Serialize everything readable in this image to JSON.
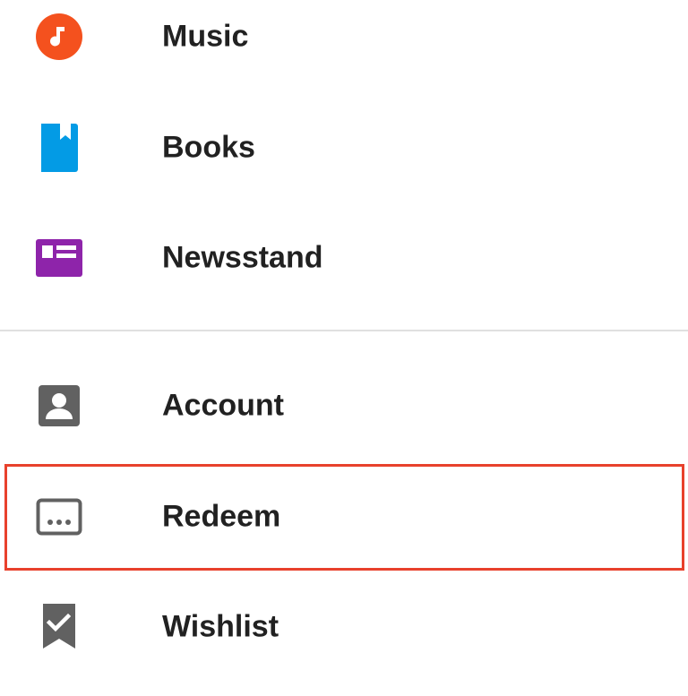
{
  "menu": {
    "items": [
      {
        "label": "Music",
        "icon": "music-note-icon",
        "icon_color": "#f4511e"
      },
      {
        "label": "Books",
        "icon": "bookmark-book-icon",
        "icon_color": "#039be5"
      },
      {
        "label": "Newsstand",
        "icon": "newsstand-icon",
        "icon_color": "#8e24aa"
      },
      {
        "label": "Account",
        "icon": "account-icon",
        "icon_color": "#616161"
      },
      {
        "label": "Redeem",
        "icon": "redeem-card-icon",
        "icon_color": "#616161"
      },
      {
        "label": "Wishlist",
        "icon": "wishlist-icon",
        "icon_color": "#616161"
      }
    ]
  },
  "highlight": {
    "target": "Redeem",
    "color": "#e8412c"
  }
}
